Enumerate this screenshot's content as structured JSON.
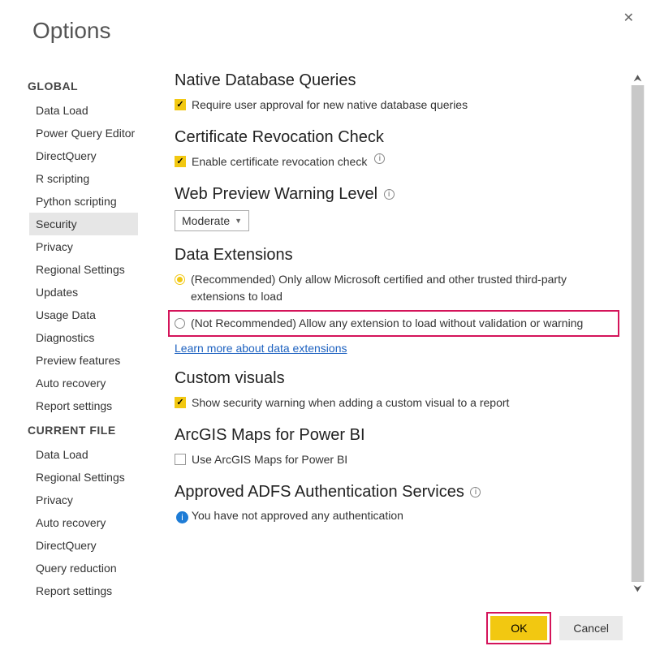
{
  "title": "Options",
  "sidebar": {
    "groups": [
      {
        "header": "GLOBAL",
        "items": [
          {
            "label": "Data Load",
            "selected": false
          },
          {
            "label": "Power Query Editor",
            "selected": false
          },
          {
            "label": "DirectQuery",
            "selected": false
          },
          {
            "label": "R scripting",
            "selected": false
          },
          {
            "label": "Python scripting",
            "selected": false
          },
          {
            "label": "Security",
            "selected": true
          },
          {
            "label": "Privacy",
            "selected": false
          },
          {
            "label": "Regional Settings",
            "selected": false
          },
          {
            "label": "Updates",
            "selected": false
          },
          {
            "label": "Usage Data",
            "selected": false
          },
          {
            "label": "Diagnostics",
            "selected": false
          },
          {
            "label": "Preview features",
            "selected": false
          },
          {
            "label": "Auto recovery",
            "selected": false
          },
          {
            "label": "Report settings",
            "selected": false
          }
        ]
      },
      {
        "header": "CURRENT FILE",
        "items": [
          {
            "label": "Data Load",
            "selected": false
          },
          {
            "label": "Regional Settings",
            "selected": false
          },
          {
            "label": "Privacy",
            "selected": false
          },
          {
            "label": "Auto recovery",
            "selected": false
          },
          {
            "label": "DirectQuery",
            "selected": false
          },
          {
            "label": "Query reduction",
            "selected": false
          },
          {
            "label": "Report settings",
            "selected": false
          }
        ]
      }
    ]
  },
  "sections": {
    "nativeDb": {
      "title": "Native Database Queries",
      "check_label": "Require user approval for new native database queries",
      "checked": true
    },
    "certRevoke": {
      "title": "Certificate Revocation Check",
      "check_label": "Enable certificate revocation check",
      "checked": true
    },
    "webPreview": {
      "title": "Web Preview Warning Level",
      "dropdown_value": "Moderate"
    },
    "dataExt": {
      "title": "Data Extensions",
      "opt1": "(Recommended) Only allow Microsoft certified and other trusted third-party extensions to load",
      "opt2": "(Not Recommended) Allow any extension to load without validation or warning",
      "selected": "opt1",
      "link": "Learn more about data extensions"
    },
    "customVisuals": {
      "title": "Custom visuals",
      "check_label": "Show security warning when adding a custom visual to a report",
      "checked": true
    },
    "arcgis": {
      "title": "ArcGIS Maps for Power BI",
      "check_label": "Use ArcGIS Maps for Power BI",
      "checked": false
    },
    "adfs": {
      "title": "Approved ADFS Authentication Services",
      "status": "You have not approved any authentication"
    }
  },
  "buttons": {
    "ok": "OK",
    "cancel": "Cancel"
  }
}
